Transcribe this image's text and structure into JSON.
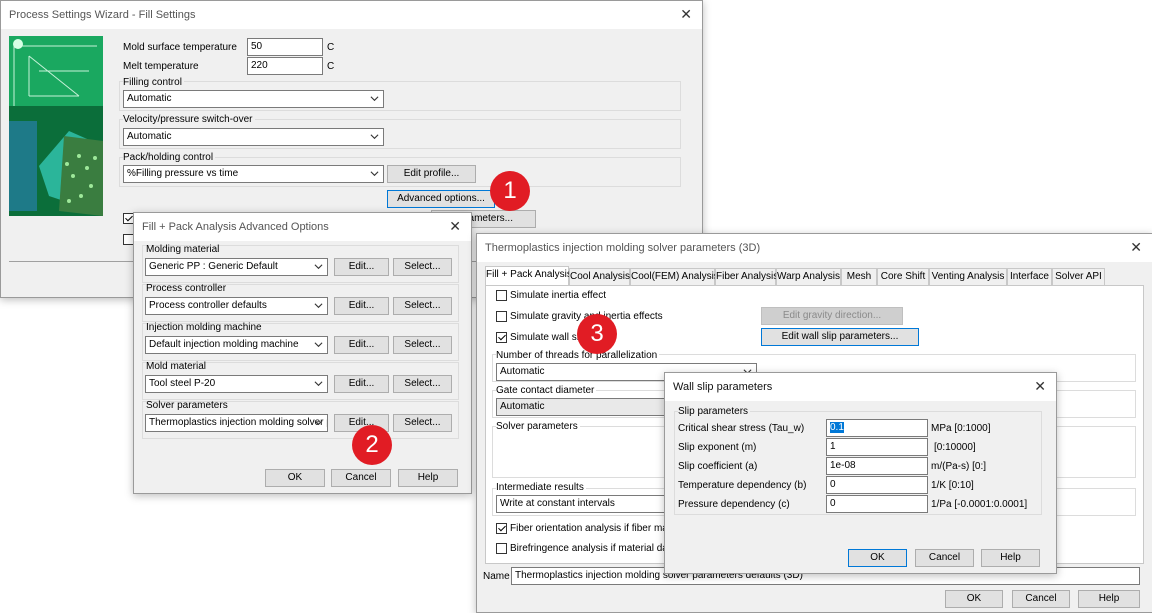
{
  "wizard": {
    "title": "Process Settings Wizard - Fill Settings",
    "mold_temp_label": "Mold surface temperature",
    "mold_temp_value": "50",
    "mold_temp_unit": "C",
    "melt_temp_label": "Melt temperature",
    "melt_temp_value": "220",
    "melt_temp_unit": "C",
    "filling_control_label": "Filling control",
    "filling_control_value": "Automatic",
    "vp_switch_label": "Velocity/pressure switch-over",
    "vp_switch_value": "Automatic",
    "pack_control_label": "Pack/holding control",
    "pack_control_value": "%Filling pressure vs time",
    "edit_profile": "Edit profile...",
    "advanced_options": "Advanced options...",
    "parameters_button_visible": "rameters..."
  },
  "advanced": {
    "title": "Fill + Pack Analysis Advanced Options",
    "rows": [
      {
        "label": "Molding material",
        "value": "Generic PP : Generic Default"
      },
      {
        "label": "Process controller",
        "value": "Process controller defaults"
      },
      {
        "label": "Injection molding machine",
        "value": "Default injection molding machine"
      },
      {
        "label": "Mold material",
        "value": "Tool steel P-20"
      },
      {
        "label": "Solver parameters",
        "value": "Thermoplastics injection molding solver pa"
      }
    ],
    "edit": "Edit...",
    "select": "Select...",
    "ok": "OK",
    "cancel": "Cancel",
    "help": "Help"
  },
  "solver": {
    "title": "Thermoplastics injection molding solver parameters (3D)",
    "tabs": [
      "Fill + Pack Analysis",
      "Cool Analysis",
      "Cool(FEM) Analysis",
      "Fiber Analysis",
      "Warp Analysis",
      "Mesh",
      "Core Shift",
      "Venting Analysis",
      "Interface",
      "Solver API"
    ],
    "inertia": "Simulate inertia effect",
    "gravity": "Simulate gravity and inertia effects",
    "wall_slip": "Simulate wall slip",
    "edit_gravity": "Edit gravity direction...",
    "edit_wall_slip": "Edit wall slip parameters...",
    "threads_label": "Number of threads for parallelization",
    "threads_value": "Automatic",
    "gate_label": "Gate contact diameter",
    "gate_value": "Automatic",
    "solver_params_label": "Solver parameters",
    "intermediate_label": "Intermediate results",
    "intermediate_value": "Write at constant intervals",
    "fiber_orientation": "Fiber orientation analysis if fiber material",
    "birefringence": "Birefringence analysis if material data inc",
    "name_label": "Name",
    "name_value": "Thermoplastics injection molding solver parameters defaults (3D)",
    "ok": "OK",
    "cancel": "Cancel",
    "help": "Help"
  },
  "wallslip": {
    "title": "Wall slip parameters",
    "group_label": "Slip parameters",
    "params": [
      {
        "label": "Critical shear stress (Tau_w)",
        "value": "0.1",
        "unit": "MPa [0:1000]"
      },
      {
        "label": "Slip exponent (m)",
        "value": "1",
        "unit": "[0:10000]"
      },
      {
        "label": "Slip coefficient (a)",
        "value": "1e-08",
        "unit": "m/(Pa-s) [0:]"
      },
      {
        "label": "Temperature dependency (b)",
        "value": "0",
        "unit": "1/K [0:10]"
      },
      {
        "label": "Pressure dependency (c)",
        "value": "0",
        "unit": "1/Pa [-0.0001:0.0001]"
      }
    ],
    "ok": "OK",
    "cancel": "Cancel",
    "help": "Help"
  },
  "badges": {
    "one": "1",
    "two": "2",
    "three": "3"
  },
  "colors": {
    "accent": "#0078d7",
    "badge": "#e11c24",
    "selection": "#0078d7"
  }
}
